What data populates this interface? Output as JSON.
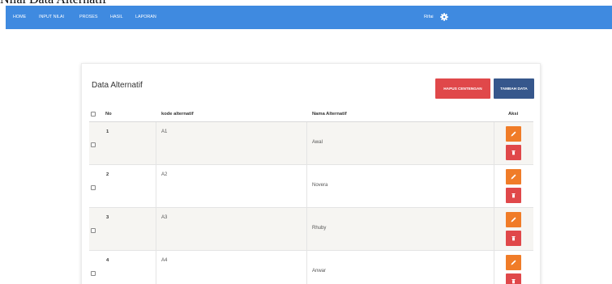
{
  "page": {
    "heading": "Nilai Data Alternatif"
  },
  "navbar": {
    "items": [
      "HOME",
      "INPUT NILAI",
      "PROSES",
      "HASIL",
      "LAPORAN"
    ],
    "user": "Rifai"
  },
  "card": {
    "title": "Data Alternatif",
    "clear_button": "HAPUS CENTENGAN",
    "add_button": "TAMBAH DATA"
  },
  "table": {
    "columns": [
      "No",
      "kode alternatif",
      "Nama Alternatif",
      "Aksi"
    ],
    "rows": [
      {
        "no": "1",
        "code": "A1",
        "name": "Awal"
      },
      {
        "no": "2",
        "code": "A2",
        "name": "Novera"
      },
      {
        "no": "3",
        "code": "A3",
        "name": "Rhuby"
      },
      {
        "no": "4",
        "code": "A4",
        "name": "Anwar"
      }
    ]
  },
  "icons": {
    "edit": "pencil-icon",
    "delete": "trash-icon",
    "settings": "gear-icon"
  },
  "colors": {
    "navbar": "#3f8ae0",
    "clear_button": "#e0484a",
    "add_button": "#36578c",
    "edit_button": "#f07c28",
    "delete_button": "#e0484a",
    "row_stripe": "#f6f5f2"
  }
}
